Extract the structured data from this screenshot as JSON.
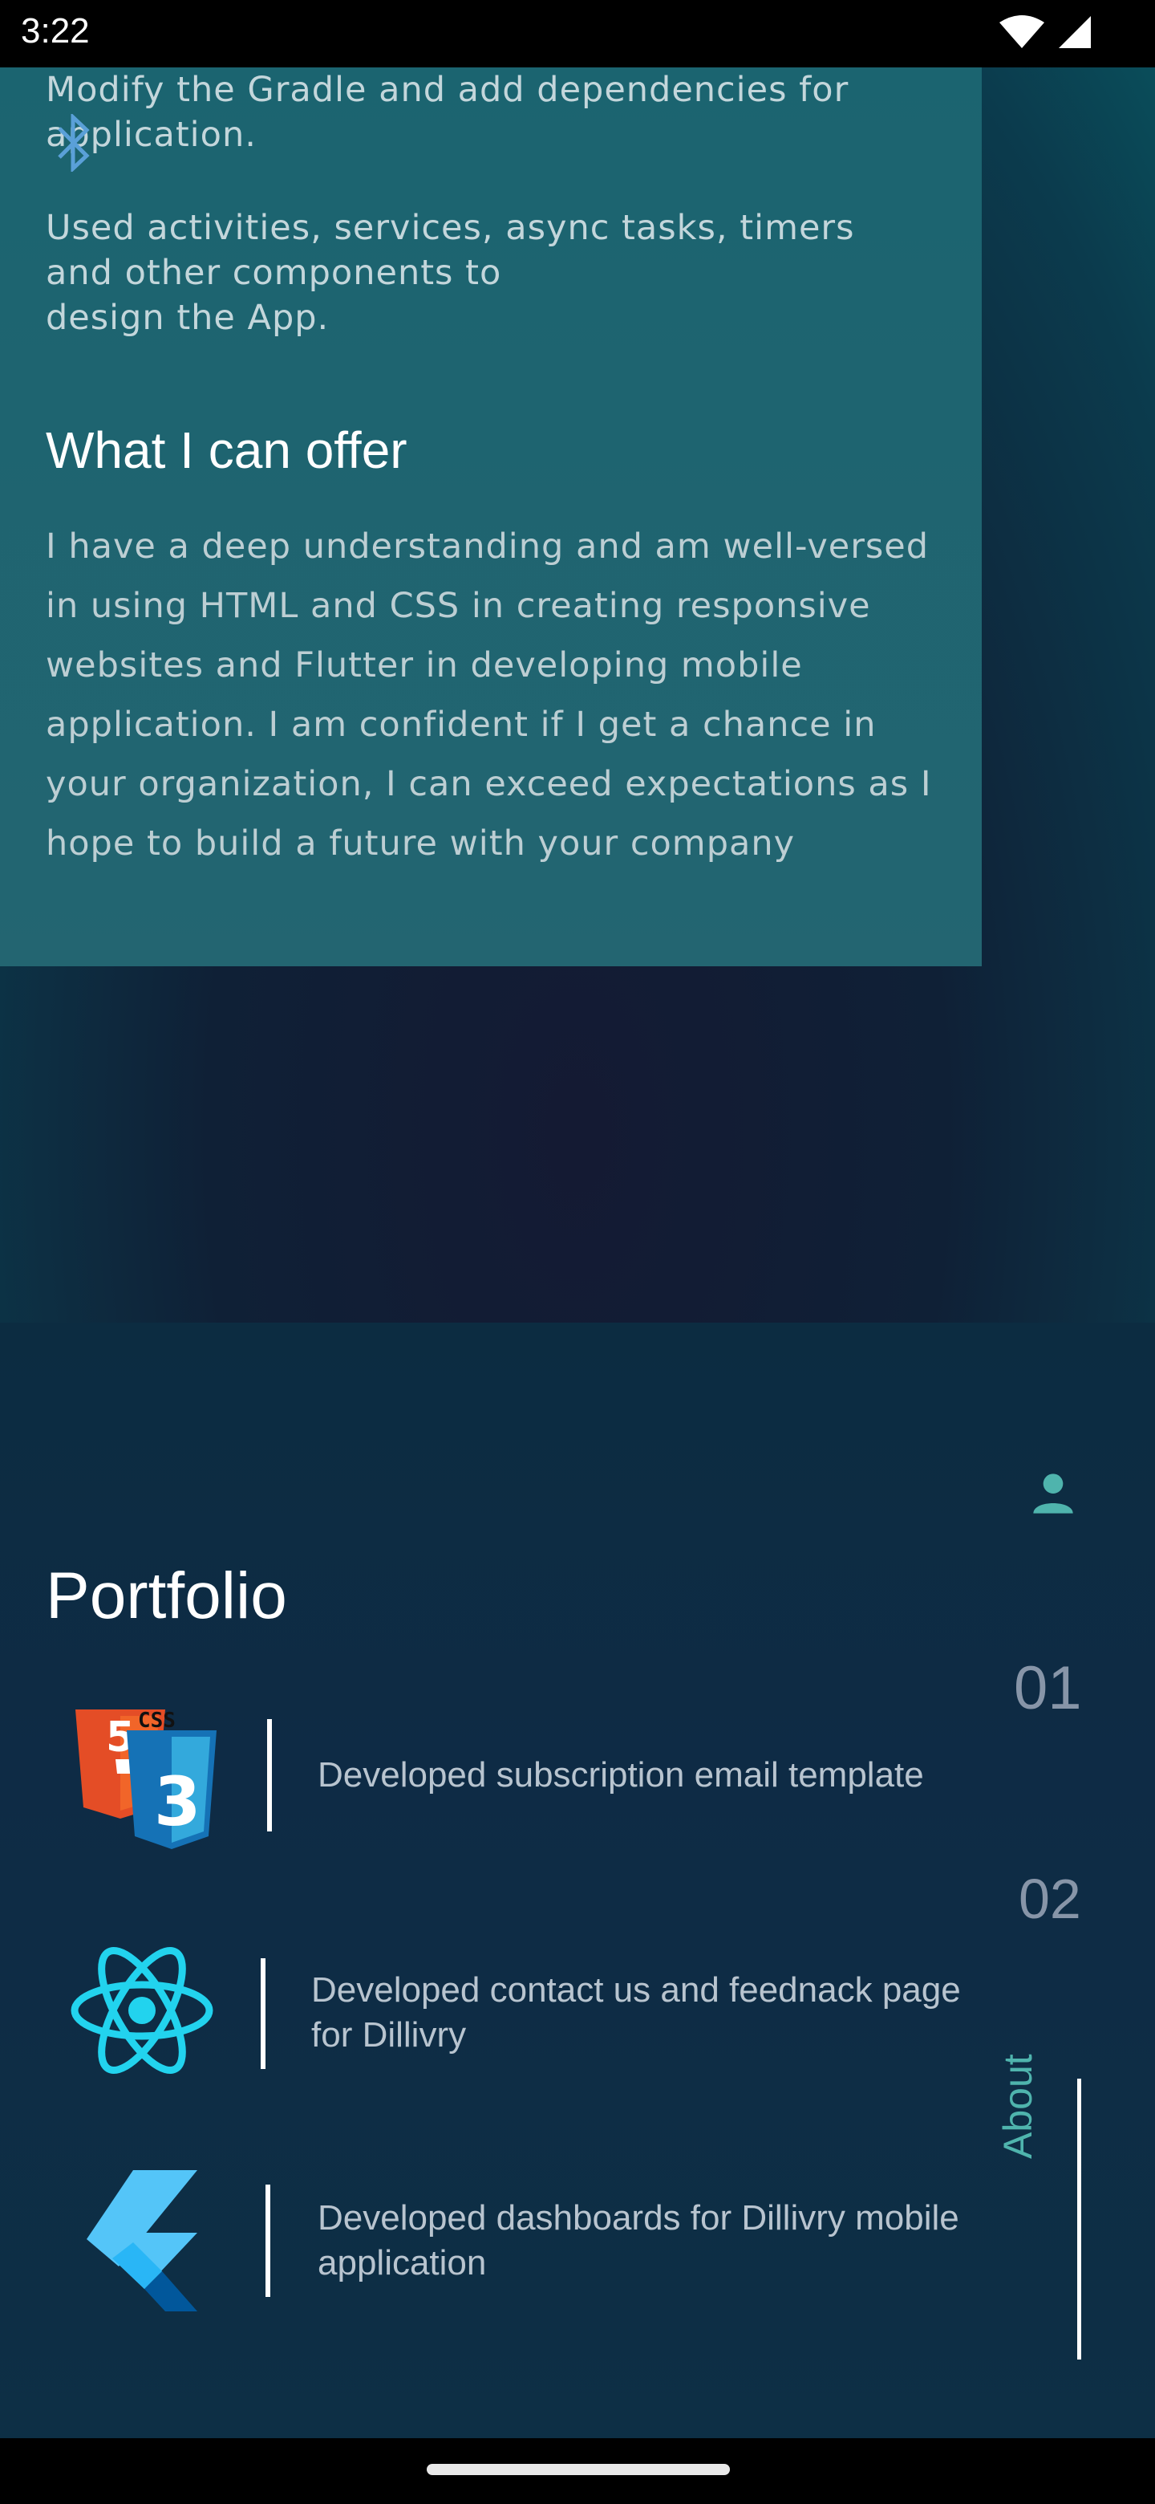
{
  "status_bar": {
    "time": "3:22"
  },
  "experience": {
    "paragraph_1": "Modify the Gradle and add dependencies for application.",
    "paragraph_2": "Used activities, services, async tasks, timers\nand other components to\ndesign the App."
  },
  "offer": {
    "heading": "What I can offer",
    "body": "I have a deep understanding and am well-versed in using HTML and CSS in creating responsive websites and Flutter in developing mobile application. I am confident if I get a chance in your organization, I can exceed expectations as I hope to build a future with your company"
  },
  "portfolio": {
    "title": "Portfolio",
    "items": [
      {
        "number": "01",
        "icon": "html-css-icon",
        "text": "Developed subscription email template"
      },
      {
        "number": "02",
        "icon": "react-icon",
        "text": "Developed contact us and feednack page for Dillivry"
      },
      {
        "number": "",
        "icon": "flutter-icon",
        "text": "Developed dashboards for Dillivry mobile application"
      }
    ]
  },
  "side_tab": {
    "label": "About"
  },
  "colors": {
    "accent": "#4fb4ad",
    "card": "#1d6470",
    "background": "#0b2a3d"
  }
}
